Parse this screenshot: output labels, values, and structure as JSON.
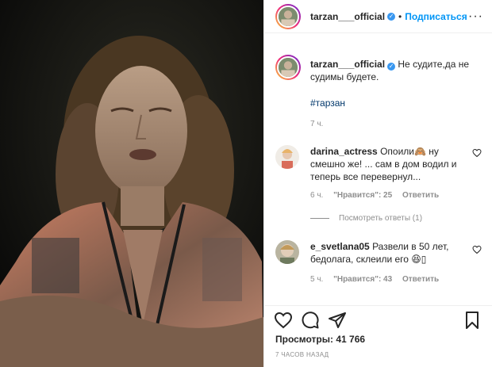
{
  "post": {
    "author": "tarzan___official",
    "follow_label": "Подписаться",
    "dot": "•",
    "more_label": "···"
  },
  "caption": {
    "author": "tarzan___official",
    "text": "Не судите,да не судимы будете.",
    "hashtag": "#тарзан",
    "time": "7 ч."
  },
  "comments": [
    {
      "user": "darina_actress",
      "text": "Опоили🙈 ну смешно же! ... сам в дом водил и теперь все перевернул...",
      "time": "6 ч.",
      "likes": "\"Нравится\": 25",
      "reply": "Ответить"
    },
    {
      "user": "e_svetlana05",
      "text": "Развели в 50 лет, бедолага, склеили его 😆▯",
      "time": "5 ч.",
      "likes": "\"Нравится\": 43",
      "reply": "Ответить"
    }
  ],
  "view_replies": "Посмотреть ответы (1)",
  "views": {
    "label": "Просмотры:",
    "count": "41 766"
  },
  "time_ago": "7 часов назад",
  "icons": [
    "heart-icon",
    "comment-icon",
    "share-icon",
    "bookmark-icon",
    "verified-icon",
    "more-icon"
  ],
  "colors": {
    "accent": "#0095f6",
    "verified": "#3897f0",
    "muted": "#8e8e8e",
    "hashtag": "#00376b"
  }
}
